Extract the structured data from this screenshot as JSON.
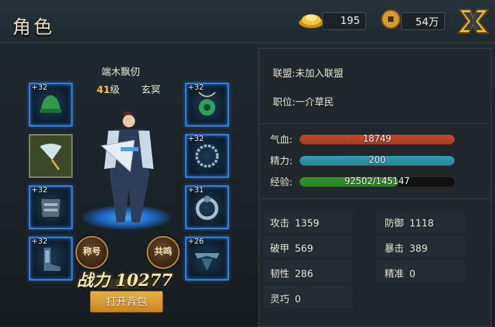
{
  "header": {
    "title": "角色",
    "gold_ingot": "195",
    "coins": "54万"
  },
  "character": {
    "name": "端木飘仞",
    "level_num": "41",
    "level_unit": "级",
    "class": "玄冥",
    "power_label": "战力",
    "power_value": "10277",
    "title_button": "称号",
    "resonance_button": "共鸣",
    "open_bag_button": "打开背包"
  },
  "equipment": {
    "left": [
      {
        "name": "hat",
        "level": "+32"
      },
      {
        "name": "weapon-fan",
        "level": ""
      },
      {
        "name": "armor",
        "level": "+32"
      },
      {
        "name": "boots",
        "level": "+32"
      }
    ],
    "right": [
      {
        "name": "jade-pendant",
        "level": "+32"
      },
      {
        "name": "necklace",
        "level": "+32"
      },
      {
        "name": "ring",
        "level": "+31"
      },
      {
        "name": "belt",
        "level": "+26"
      }
    ]
  },
  "info": {
    "alliance": "联盟:未加入联盟",
    "position": "职位:一介草民"
  },
  "bars": {
    "hp_label": "气血:",
    "hp_value": "18749",
    "hp_fraction": 1.0,
    "energy_label": "精力:",
    "energy_value": "200",
    "energy_fraction": 1.0,
    "exp_label": "经验:",
    "exp_value": "92502/145147",
    "exp_fraction": 0.637,
    "colors": {
      "hp": "#c24a2c",
      "energy": "#2f9fb4",
      "exp": "#2f9b2a"
    }
  },
  "stats": {
    "attack_label": "攻击",
    "attack_value": "1359",
    "defense_label": "防御",
    "defense_value": "1118",
    "pierce_label": "破甲",
    "pierce_value": "569",
    "crit_label": "暴击",
    "crit_value": "389",
    "tough_label": "韧性",
    "tough_value": "286",
    "accuracy_label": "精准",
    "accuracy_value": "0",
    "agility_label": "灵巧",
    "agility_value": "0"
  }
}
